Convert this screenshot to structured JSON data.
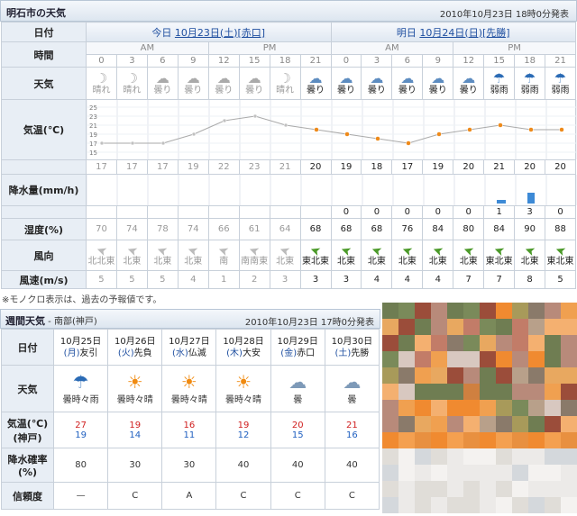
{
  "top": {
    "title": "明石市の天気",
    "issued": "2010年10月23日 18時0分発表",
    "row_labels": {
      "date": "日付",
      "time": "時間",
      "weather": "天気",
      "temp": "気温(℃)",
      "rain": "降水量(mm/h)",
      "humidity": "湿度(%)",
      "wind_dir": "風向",
      "wind_speed": "風速(m/s)"
    },
    "today": {
      "prefix": "今日 ",
      "date": "10月23日(土)",
      "rokuyo": "[赤口]"
    },
    "tomorrow": {
      "prefix": "明日 ",
      "date": "10月24日(日)",
      "rokuyo": "[先勝]"
    },
    "am": "AM",
    "pm": "PM",
    "hours": [
      "0",
      "3",
      "6",
      "9",
      "12",
      "15",
      "18",
      "21",
      "0",
      "3",
      "6",
      "9",
      "12",
      "15",
      "18",
      "21"
    ],
    "weather": [
      "晴れ",
      "晴れ",
      "曇り",
      "曇り",
      "曇り",
      "曇り",
      "晴れ",
      "曇り",
      "曇り",
      "曇り",
      "曇り",
      "曇り",
      "曇り",
      "弱雨",
      "弱雨",
      "弱雨"
    ],
    "weather_icons": [
      "moon-icon",
      "moon-icon",
      "cloud-icon",
      "cloud-icon",
      "cloud-icon",
      "cloud-icon",
      "moon-icon",
      "cloud-icon",
      "cloud-icon",
      "cloud-icon",
      "cloud-icon",
      "cloud-icon",
      "cloud-icon",
      "umbrella-icon",
      "umbrella-icon",
      "umbrella-icon"
    ],
    "temps": [
      "17",
      "17",
      "17",
      "19",
      "22",
      "23",
      "21",
      "20",
      "19",
      "18",
      "17",
      "19",
      "20",
      "21",
      "20",
      "20"
    ],
    "rain": [
      "0",
      "0",
      "0",
      "0",
      "0",
      "1",
      "3",
      "0"
    ],
    "humidity": [
      "70",
      "74",
      "78",
      "74",
      "66",
      "61",
      "64",
      "68",
      "68",
      "68",
      "76",
      "84",
      "80",
      "84",
      "90",
      "88"
    ],
    "wind_dir": [
      "北北東",
      "北東",
      "北東",
      "北東",
      "南",
      "南南東",
      "北東",
      "東北東",
      "北東",
      "北東",
      "北東",
      "北東",
      "北東",
      "東北東",
      "北東",
      "東北東"
    ],
    "wind_speed": [
      "5",
      "5",
      "5",
      "4",
      "1",
      "2",
      "3",
      "3",
      "3",
      "4",
      "4",
      "4",
      "7",
      "7",
      "8",
      "5"
    ],
    "y_axis": [
      "25",
      "23",
      "21",
      "19",
      "17",
      "15"
    ],
    "chart_data": {
      "type": "line",
      "x": [
        "0",
        "3",
        "6",
        "9",
        "12",
        "15",
        "18",
        "21",
        "0",
        "3",
        "6",
        "9",
        "12",
        "15",
        "18",
        "21"
      ],
      "values": [
        17,
        17,
        17,
        19,
        22,
        23,
        21,
        20,
        19,
        18,
        17,
        19,
        20,
        21,
        20,
        20
      ],
      "ylim": [
        15,
        25
      ],
      "colors": {
        "past": "#c0c0c0",
        "forecast": "#ee8a1a"
      }
    },
    "note": "※モノクロ表示は、過去の予報値です。"
  },
  "weekly": {
    "title": "週間天気",
    "area": " - 南部(神戸)",
    "issued": "2010年10月23日 17時0分発表",
    "row_labels": {
      "date": "日付",
      "weather": "天気",
      "temp": "気温(℃)",
      "temp_sub": "(神戸)",
      "rain_prob": "降水確率",
      "rain_prob_unit": "(%)",
      "reliability": "信頼度"
    },
    "days": [
      {
        "date": "10月25日",
        "dow": "(月)",
        "rokuyo": "友引",
        "weather": "曇時々雨",
        "icon": "umbrella-icon",
        "hi": "27",
        "lo": "19",
        "prob": "80",
        "rel": "—"
      },
      {
        "date": "10月26日",
        "dow": "(火)",
        "rokuyo": "先負",
        "weather": "曇時々晴",
        "icon": "sun-cloud-icon",
        "hi": "19",
        "lo": "14",
        "prob": "30",
        "rel": "C"
      },
      {
        "date": "10月27日",
        "dow": "(水)",
        "rokuyo": "仏滅",
        "weather": "曇時々晴",
        "icon": "sun-cloud-icon",
        "hi": "16",
        "lo": "11",
        "prob": "30",
        "rel": "A"
      },
      {
        "date": "10月28日",
        "dow": "(木)",
        "rokuyo": "大安",
        "weather": "曇時々晴",
        "icon": "sun-cloud-icon",
        "hi": "19",
        "lo": "12",
        "prob": "40",
        "rel": "C"
      },
      {
        "date": "10月29日",
        "dow": "(金)",
        "rokuyo": "赤口",
        "weather": "曇",
        "icon": "cloud-icon",
        "hi": "20",
        "lo": "15",
        "prob": "40",
        "rel": "C"
      },
      {
        "date": "10月30日",
        "dow": "(土)",
        "rokuyo": "先勝",
        "weather": "曇",
        "icon": "cloud-icon",
        "hi": "21",
        "lo": "16",
        "prob": "40",
        "rel": "C"
      }
    ]
  },
  "ad": {
    "icon": "advertisement-mosaic"
  }
}
